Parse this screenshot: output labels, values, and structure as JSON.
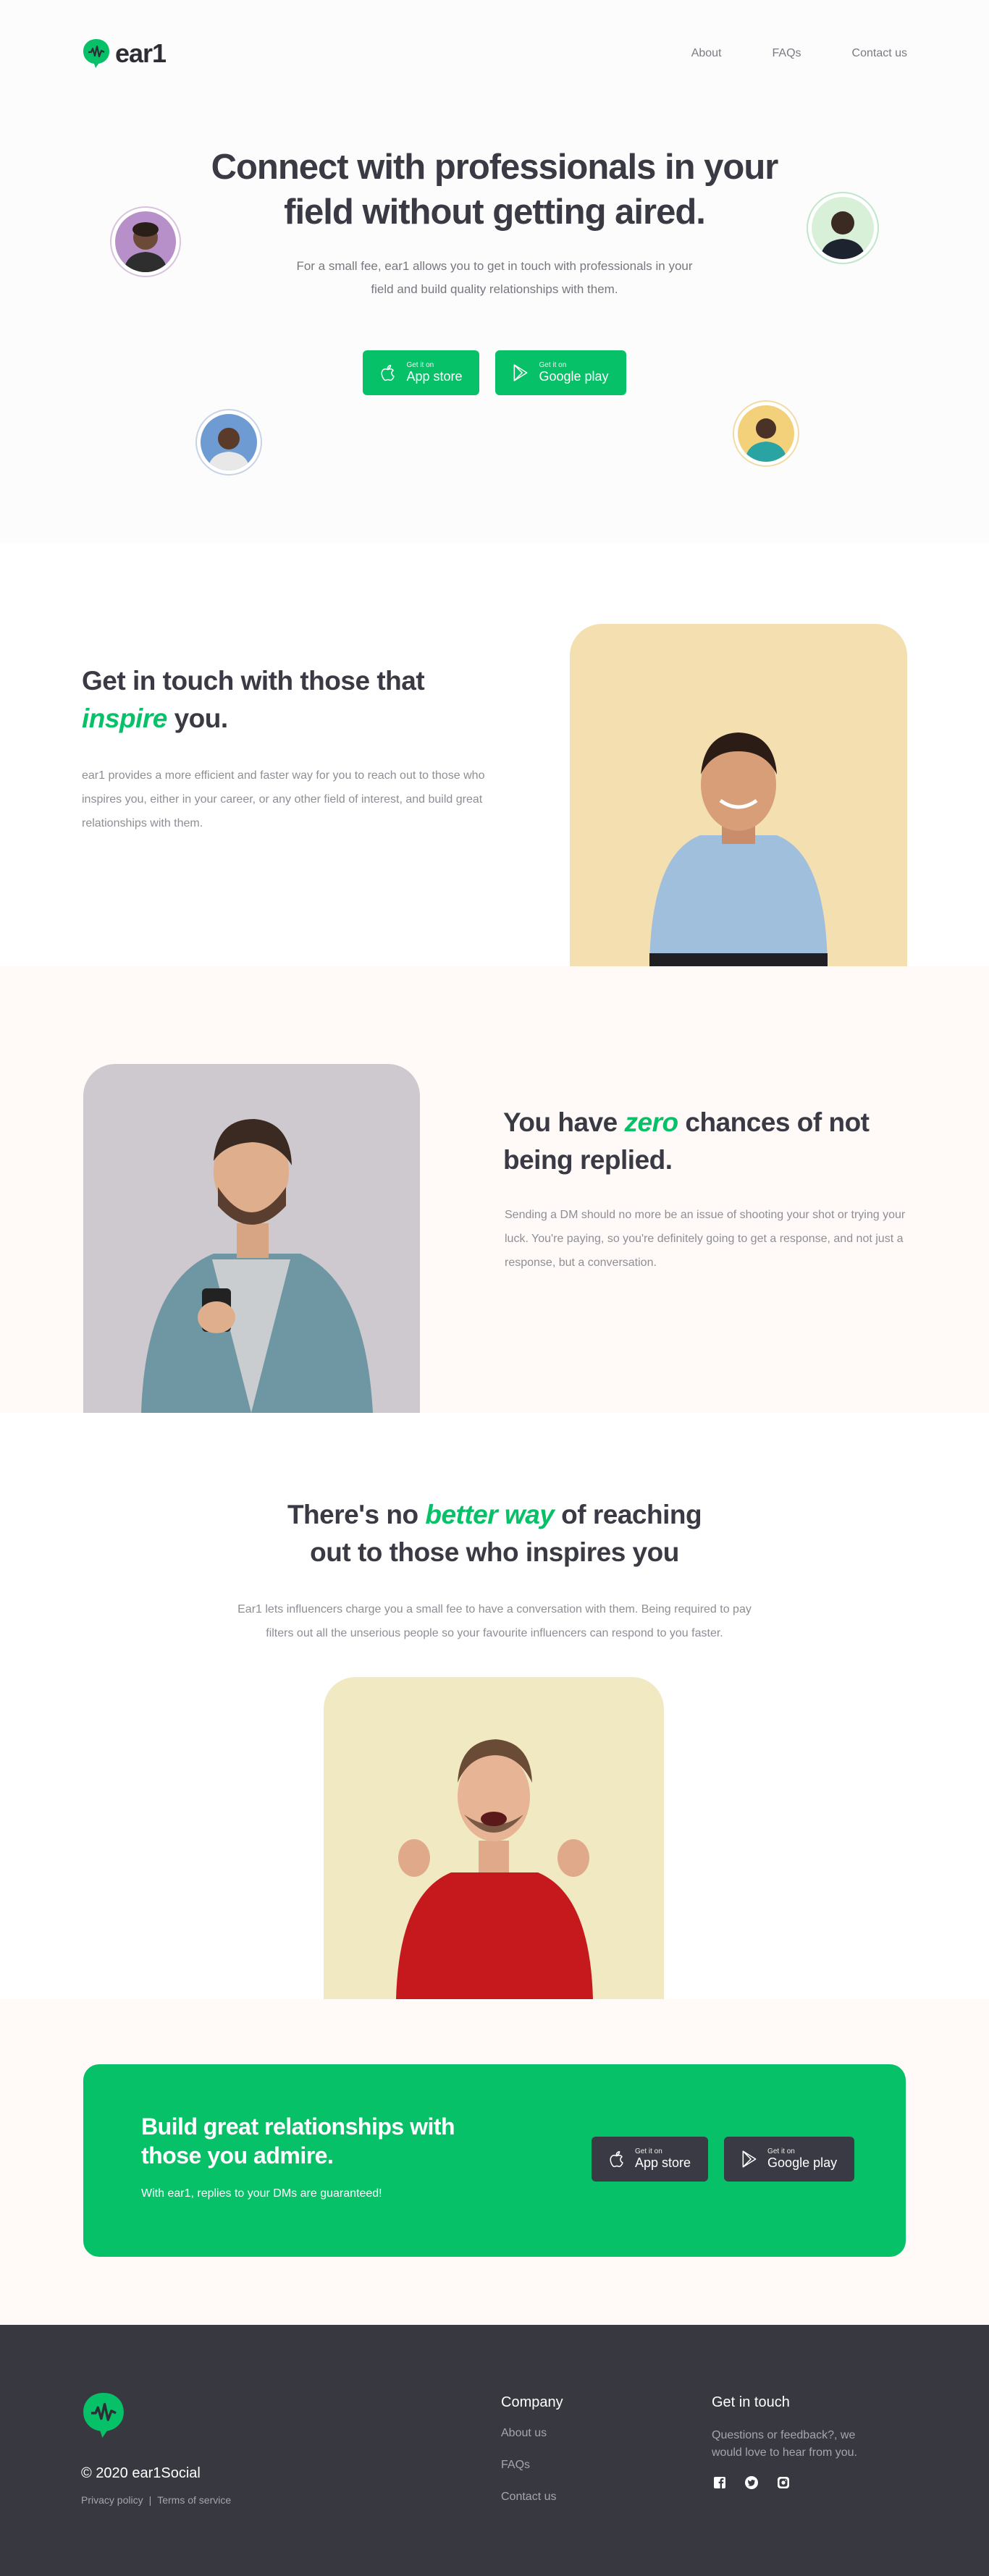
{
  "brand": {
    "name": "ear1",
    "accent": "#06c167",
    "dark": "#383841"
  },
  "nav": {
    "links": [
      "About",
      "FAQs",
      "Contact us"
    ]
  },
  "hero": {
    "title_line1": "Connect with professionals in your",
    "title_line2": "field without getting aired.",
    "subtitle": "For a small fee, ear1 allows you to get in touch with professionals in your field and build quality relationships with them."
  },
  "stores": {
    "app": {
      "small": "Get it on",
      "label": "App store",
      "icon": "apple-icon"
    },
    "play": {
      "small": "Get it on",
      "label": "Google play",
      "icon": "play-icon"
    }
  },
  "inspire": {
    "title_a": "Get in touch with those that",
    "title_em": "inspire",
    "title_b": " you.",
    "body": "ear1 provides a more efficient and faster way for you to reach out to those who inspires you, either in your career, or any other field of interest, and build great relationships with them."
  },
  "zero": {
    "title_a": "You have ",
    "title_em": "zero",
    "title_b": " chances of not being replied.",
    "body": "Sending a DM should no more be an issue of shooting your shot or trying your luck. You're paying, so you're definitely going to get a response, and not just a response, but a conversation."
  },
  "better": {
    "title_a": "There's no ",
    "title_em": "better way",
    "title_b": " of reaching",
    "title_line2": "out to those who inspires you",
    "body": "Ear1 lets influencers charge you a small fee to have a conversation with them. Being required to pay filters out all the unserious people so your favourite influencers can respond to you faster."
  },
  "cta": {
    "title": "Build great relationships with those you admire.",
    "subtitle": "With ear1, replies to your DMs are guaranteed!"
  },
  "footer": {
    "copyright": "© 2020 ear1Social",
    "privacy": "Privacy policy",
    "separator": "|",
    "terms": "Terms of service",
    "company_title": "Company",
    "company_links": [
      "About us",
      "FAQs",
      "Contact us"
    ],
    "contact_title": "Get in touch",
    "contact_text": "Questions or feedback?, we would love to hear from you.",
    "socials": [
      "facebook-icon",
      "twitter-icon",
      "instagram-icon"
    ]
  }
}
